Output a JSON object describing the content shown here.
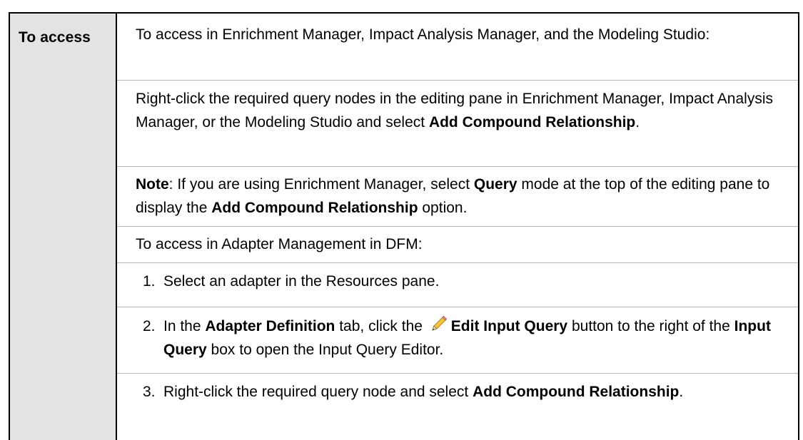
{
  "table": {
    "header": "To access",
    "intro": "To access in Enrichment Manager, Impact Analysis Manager, and the Modeling Studio:",
    "right_click": {
      "prefix": "Right-click the required query nodes in the editing pane in Enrichment Manager, Impact Analysis Manager, or the Modeling Studio and select ",
      "bold": "Add Compound Relationship",
      "suffix": "."
    },
    "note": {
      "label": "Note",
      "text1": ": If you are using Enrichment Manager, select ",
      "bold1": "Query",
      "text2": " mode at the top of the editing pane to display the ",
      "bold2": "Add Compound Relationship",
      "text3": " option."
    },
    "dfm_intro": "To access in Adapter Management in DFM:",
    "steps": [
      {
        "number": "1.",
        "text": "Select an adapter in the Resources pane."
      },
      {
        "number": "2.",
        "t1": "In the ",
        "b1": "Adapter Definition",
        "t2": " tab, click the ",
        "icon": "pencil-edit-icon",
        "b2": "Edit Input Query",
        "t3": " button to the right of the ",
        "b3": "Input Query",
        "t4": " box to open the Input Query Editor."
      },
      {
        "number": "3.",
        "t1": "Right-click the required query node and select ",
        "b1": "Add Compound Relationship",
        "t2": "."
      }
    ]
  }
}
